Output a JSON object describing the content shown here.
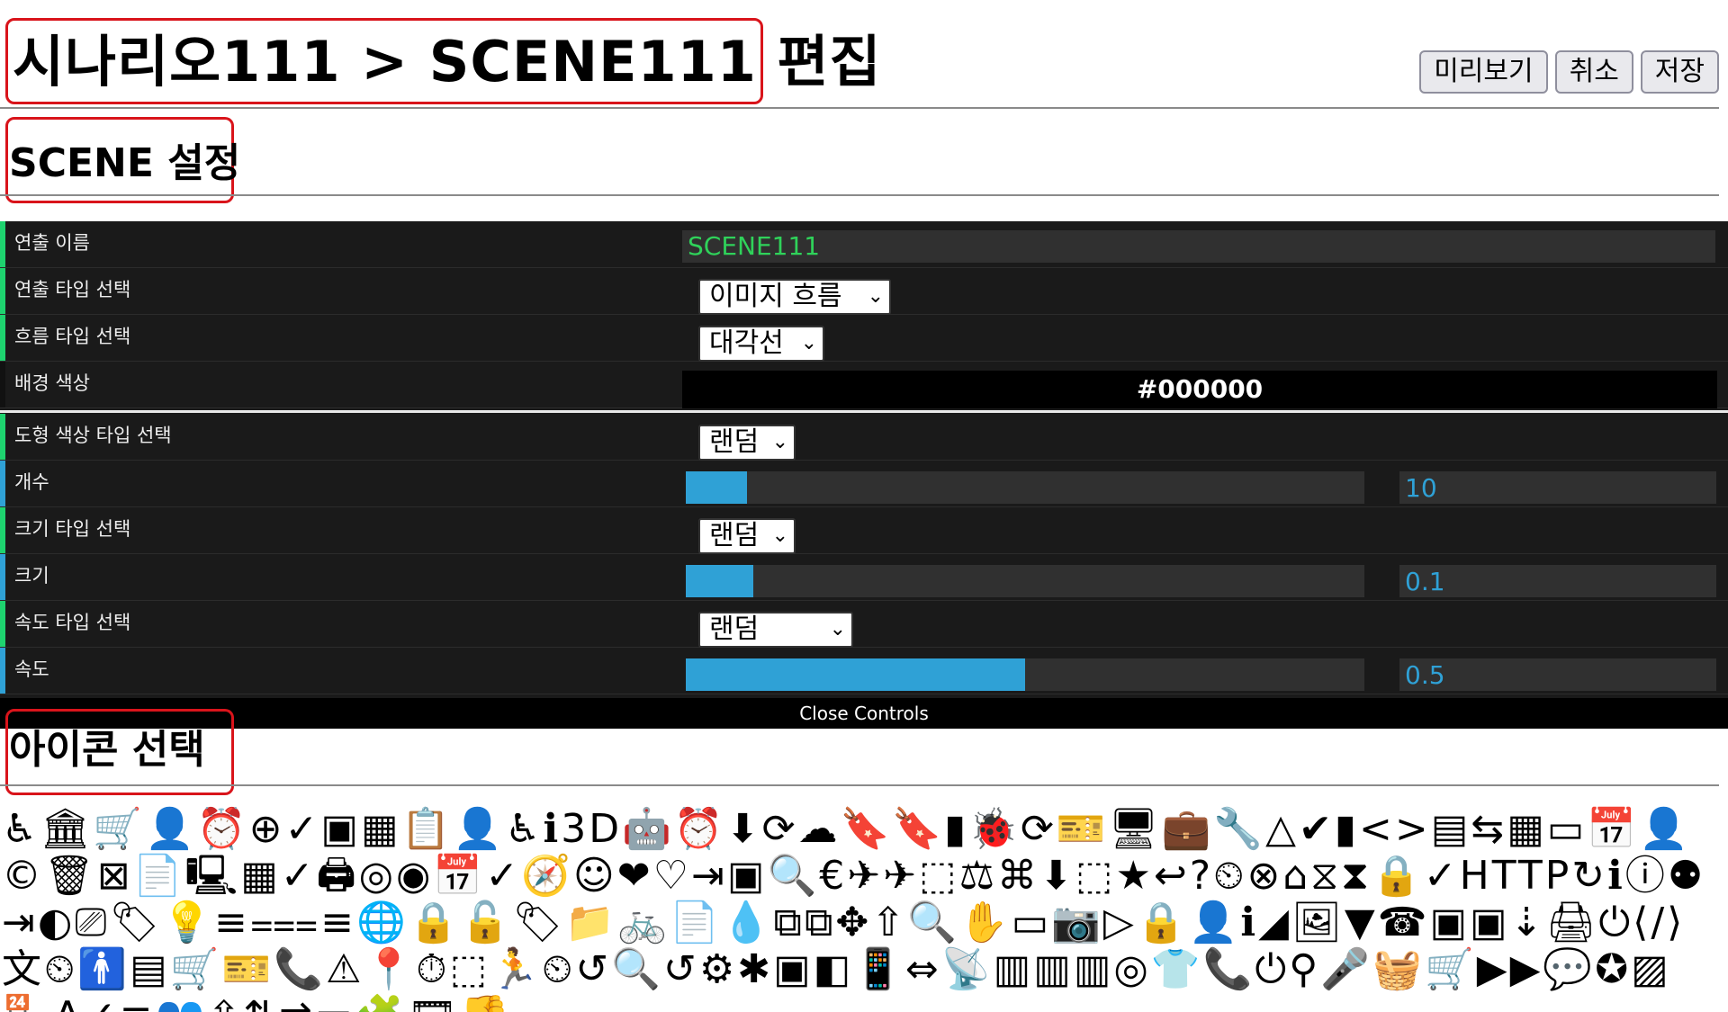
{
  "header": {
    "title": "시나리오111 > SCENE111 편집",
    "buttons": {
      "preview": "미리보기",
      "cancel": "취소",
      "save": "저장"
    }
  },
  "sections": {
    "scene": "SCENE 설정",
    "icons": "아이콘 선택"
  },
  "controls": {
    "name": {
      "label": "연출 이름",
      "value": "SCENE111"
    },
    "effect_type": {
      "label": "연출 타입 선택",
      "value": "이미지 흐름"
    },
    "flow_type": {
      "label": "흐름 타입 선택",
      "value": "대각선"
    },
    "bg_color": {
      "label": "배경 색상",
      "value": "#000000"
    },
    "shape_color_type": {
      "label": "도형 색상 타입 선택",
      "value": "랜덤"
    },
    "count": {
      "label": "개수",
      "value": "10",
      "fraction": 0.09
    },
    "size_type": {
      "label": "크기 타입 선택",
      "value": "랜덤"
    },
    "size": {
      "label": "크기",
      "value": "0.1",
      "fraction": 0.1
    },
    "speed_type": {
      "label": "속도 타입 선택",
      "value": "랜덤"
    },
    "speed": {
      "label": "속도",
      "value": "0.5",
      "fraction": 0.5
    },
    "close": "Close Controls"
  },
  "colors": {
    "accent_green": "#2fd25a",
    "accent_blue": "#2fa1d6",
    "highlight_red": "#d9141b"
  },
  "icon_grid": {
    "glyphs": "♿🏛🛒👤⏰⊕✓▣▦📋👤♿ℹ3D🤖⏰⬇⟳☁🔖🔖▮🐞⟳🎫🖥💼🔧△✔▮<>▤⇆▦▭📅👤©🗑⊠📄🖳▦✓🖨◎◉📅✓🧭☺❤♡⇥▣🔍€✈✈⬚⚖⌘⬇⬚★↩?⏲⊗⌂⧖⧗🔒✓HTTP↻ℹⓘ⚉⇥◐⎚🏷💡≡⩶≡🌐🔒🔓🏷📁🚲📄💧⧉⧉✥⇧🔍✋▭📷▷🔒👤ℹ◢🖼▼☎▣▣⇣🖨⏻⟨/⟩文⏲🚹▤🛒🎫📞⚠📍⏱⬚🏃⏲↺🔍↺⚙✱▣◧📱⇔📡▥▥▥◎👕📞⏻⚲🎤🧺🛒▶▶💬✪▨🏪A✓≡👥⇧⇅⇄▭🧩🎞👎"
  }
}
